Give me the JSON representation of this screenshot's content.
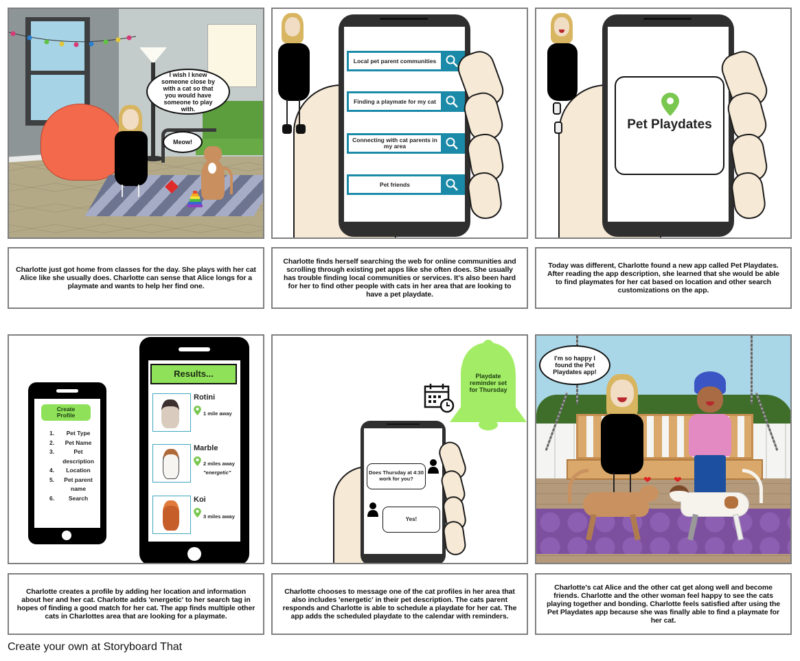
{
  "storyboard": {
    "footer_text": "Create your own at Storyboard That",
    "colors": {
      "border": "#7f7f7f",
      "search_teal": "#1a8aa8",
      "accent_green": "#8fe15a",
      "pin_green": "#7ac74f"
    },
    "panels": [
      {
        "scene": "living-room",
        "speech": [
          "I wish I knew someone close by with a cat so that you would have someone to play with.",
          "Meow!"
        ],
        "caption": "Charlotte just got home from classes for the day. She plays with her cat Alice like she usually does. Charlotte can sense that Alice longs for a playmate and wants to help her find one."
      },
      {
        "scene": "phone-search",
        "searches": [
          "Local pet parent communities",
          "Finding a playmate for my cat",
          "Connecting with cat parents in my area",
          "Pet friends"
        ],
        "search_icon": "magnifier-icon",
        "caption": "Charlotte finds herself searching the web for online communities and scrolling through existing pet apps like she often does. She usually has trouble finding local communities or services. It's also been hard for her to find other people with cats in her area that are looking to have a pet playdate."
      },
      {
        "scene": "app-discovery",
        "app_name": "Pet Playdates",
        "app_icon": "location-pin-icon",
        "caption": "Today was different, Charlotte found a new app called Pet Playdates. After reading the app description, she learned that she would be able to find playmates for her cat based on location and other search customizations on the app."
      },
      {
        "scene": "profile-and-results",
        "create_profile": {
          "title": "Create Profile",
          "steps": [
            {
              "num": "1.",
              "label": "Pet Type"
            },
            {
              "num": "2.",
              "label": "Pet Name"
            },
            {
              "num": "3.",
              "label": "Pet description"
            },
            {
              "num": "4.",
              "label": "Location"
            },
            {
              "num": "5.",
              "label": "Pet parent name"
            },
            {
              "num": "6.",
              "label": "Search"
            }
          ]
        },
        "results": {
          "title": "Results...",
          "items": [
            {
              "name": "Rotini",
              "distance": "1 mile away",
              "tag": ""
            },
            {
              "name": "Marble",
              "distance": "2 miles away",
              "tag": "\"energetic\""
            },
            {
              "name": "Koi",
              "distance": "3 miles away",
              "tag": ""
            }
          ]
        },
        "caption": "Charlotte creates a profile by adding her location and information about her and her cat. Charlotte adds 'energetic' to her search tag in hopes of finding a good match for her cat. The app finds multiple other cats in Charlottes area that are looking for a playmate."
      },
      {
        "scene": "messaging",
        "reminder": "Playdate reminder set for Thursday",
        "messages": [
          {
            "from": "other",
            "text": "Does Thursday at 4:30 work for you?"
          },
          {
            "from": "me",
            "text": "Yes!"
          }
        ],
        "caption": "Charlotte chooses to message one of the cat profiles in her area that also includes 'energetic' in their pet description. The cats parent responds and Charlotte is able to schedule a playdate for her cat. The app adds the scheduled playdate to the calendar with reminders."
      },
      {
        "scene": "porch-playdate",
        "speech": [
          "I'm so happy I found the Pet Playdates app!"
        ],
        "caption": "Charlotte's cat Alice and the other cat get along well and become friends. Charlotte and the other woman feel happy to see the cats playing together and bonding. Charlotte feels satisfied after using the Pet Playdates app because she was finally able to find a playmate for her cat."
      }
    ]
  }
}
